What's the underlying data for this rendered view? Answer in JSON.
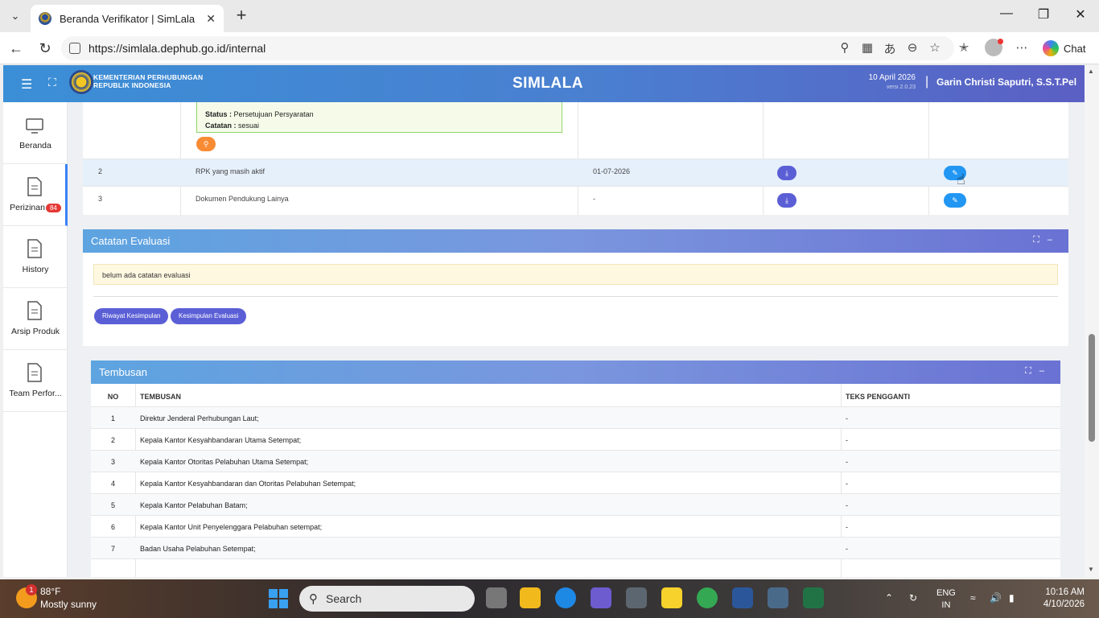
{
  "browser": {
    "tab_title": "Beranda Verifikator | SimLala",
    "url": "https://simlala.dephub.go.id/internal",
    "chat_label": "Chat"
  },
  "header": {
    "org_line1": "KEMENTERIAN PERHUBUNGAN",
    "org_line2": "REPUBLIK INDONESIA",
    "app_title": "SIMLALA",
    "date": "10 April 2026",
    "version": "versi 2.0.23",
    "separator": "|",
    "user": "Garin Christi Saputri, S.S.T.Pel"
  },
  "sidebar": {
    "items": [
      {
        "label": "Beranda"
      },
      {
        "label": "Perizinan",
        "badge": "84"
      },
      {
        "label": "History"
      },
      {
        "label": "Arsip Produk"
      },
      {
        "label": "Team Perfor..."
      }
    ]
  },
  "docs_table": {
    "status_line": "Status : Persetujuan Persyaratan",
    "status_key": "Status :",
    "status_val": "Persetujuan Persyaratan",
    "catatan_key": "Catatan :",
    "catatan_val": "sesuai",
    "rows": [
      {
        "no": "2",
        "name": "RPK yang masih aktif",
        "date": "01-07-2026"
      },
      {
        "no": "3",
        "name": "Dokumen Pendukung Lainya",
        "date": "-"
      }
    ]
  },
  "evaluasi": {
    "title": "Catatan Evaluasi",
    "note": "belum ada catatan evaluasi",
    "btn_riwayat": "Riwayat Kesimpulan",
    "btn_kesimpulan": "Kesimpulan Evaluasi"
  },
  "tembusan": {
    "title": "Tembusan",
    "headers": {
      "no": "NO",
      "tembusan": "TEMBUSAN",
      "teks": "TEKS PENGGANTI"
    },
    "rows": [
      {
        "no": "1",
        "tembusan": "Direktur Jenderal Perhubungan Laut;",
        "teks": "-"
      },
      {
        "no": "2",
        "tembusan": "Kepala Kantor Kesyahbandaran Utama Setempat;",
        "teks": "-"
      },
      {
        "no": "3",
        "tembusan": "Kepala Kantor Otoritas Pelabuhan Utama Setempat;",
        "teks": "-"
      },
      {
        "no": "4",
        "tembusan": "Kepala Kantor Kesyahbandaran dan Otoritas Pelabuhan Setempat;",
        "teks": "-"
      },
      {
        "no": "5",
        "tembusan": "Kepala Kantor Pelabuhan Batam;",
        "teks": "-"
      },
      {
        "no": "6",
        "tembusan": "Kepala Kantor Unit Penyelenggara Pelabuhan setempat;",
        "teks": "-"
      },
      {
        "no": "7",
        "tembusan": "Badan Usaha Pelabuhan Setempat;",
        "teks": "-"
      }
    ]
  },
  "taskbar": {
    "weather_badge": "1",
    "temperature": "88°F",
    "weather": "Mostly sunny",
    "search": "Search",
    "lang1": "ENG",
    "lang2": "IN",
    "time": "10:16 AM",
    "date": "4/10/2026"
  },
  "colors": {
    "header_start": "#3b8fd6",
    "header_end": "#5b5fc4",
    "button_purple": "#5b5fd6",
    "button_blue": "#2196f3",
    "badge_red": "#e53935",
    "search_orange": "#f98b34"
  }
}
